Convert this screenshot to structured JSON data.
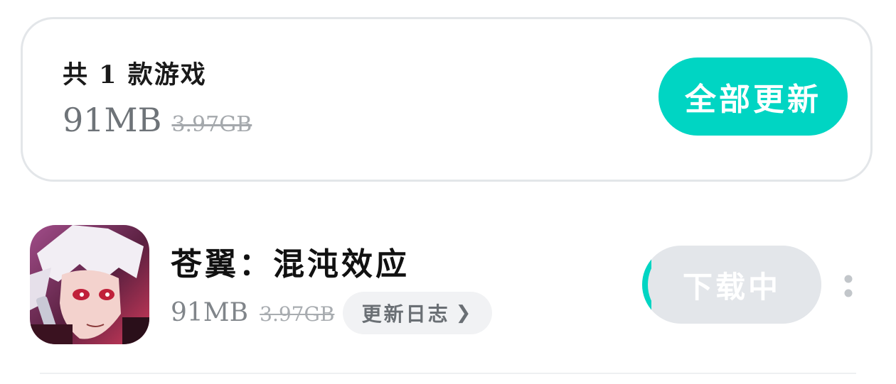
{
  "summary": {
    "title": "共 1 款游戏",
    "size": "91MB",
    "original_size": "3.97GB",
    "update_all_label": "全部更新"
  },
  "game": {
    "name": "苍翼：混沌效应",
    "size": "91MB",
    "original_size": "3.97GB",
    "changelog_label": "更新日志",
    "changelog_icon": "chevron-right-icon",
    "download_label": "下载中",
    "download_progress": 0.03,
    "more_icon": "more-vertical-icon"
  },
  "colors": {
    "accent": "#00d5c3",
    "disabled_button": "#e3e6ea",
    "card_border": "#e3e6e9"
  }
}
